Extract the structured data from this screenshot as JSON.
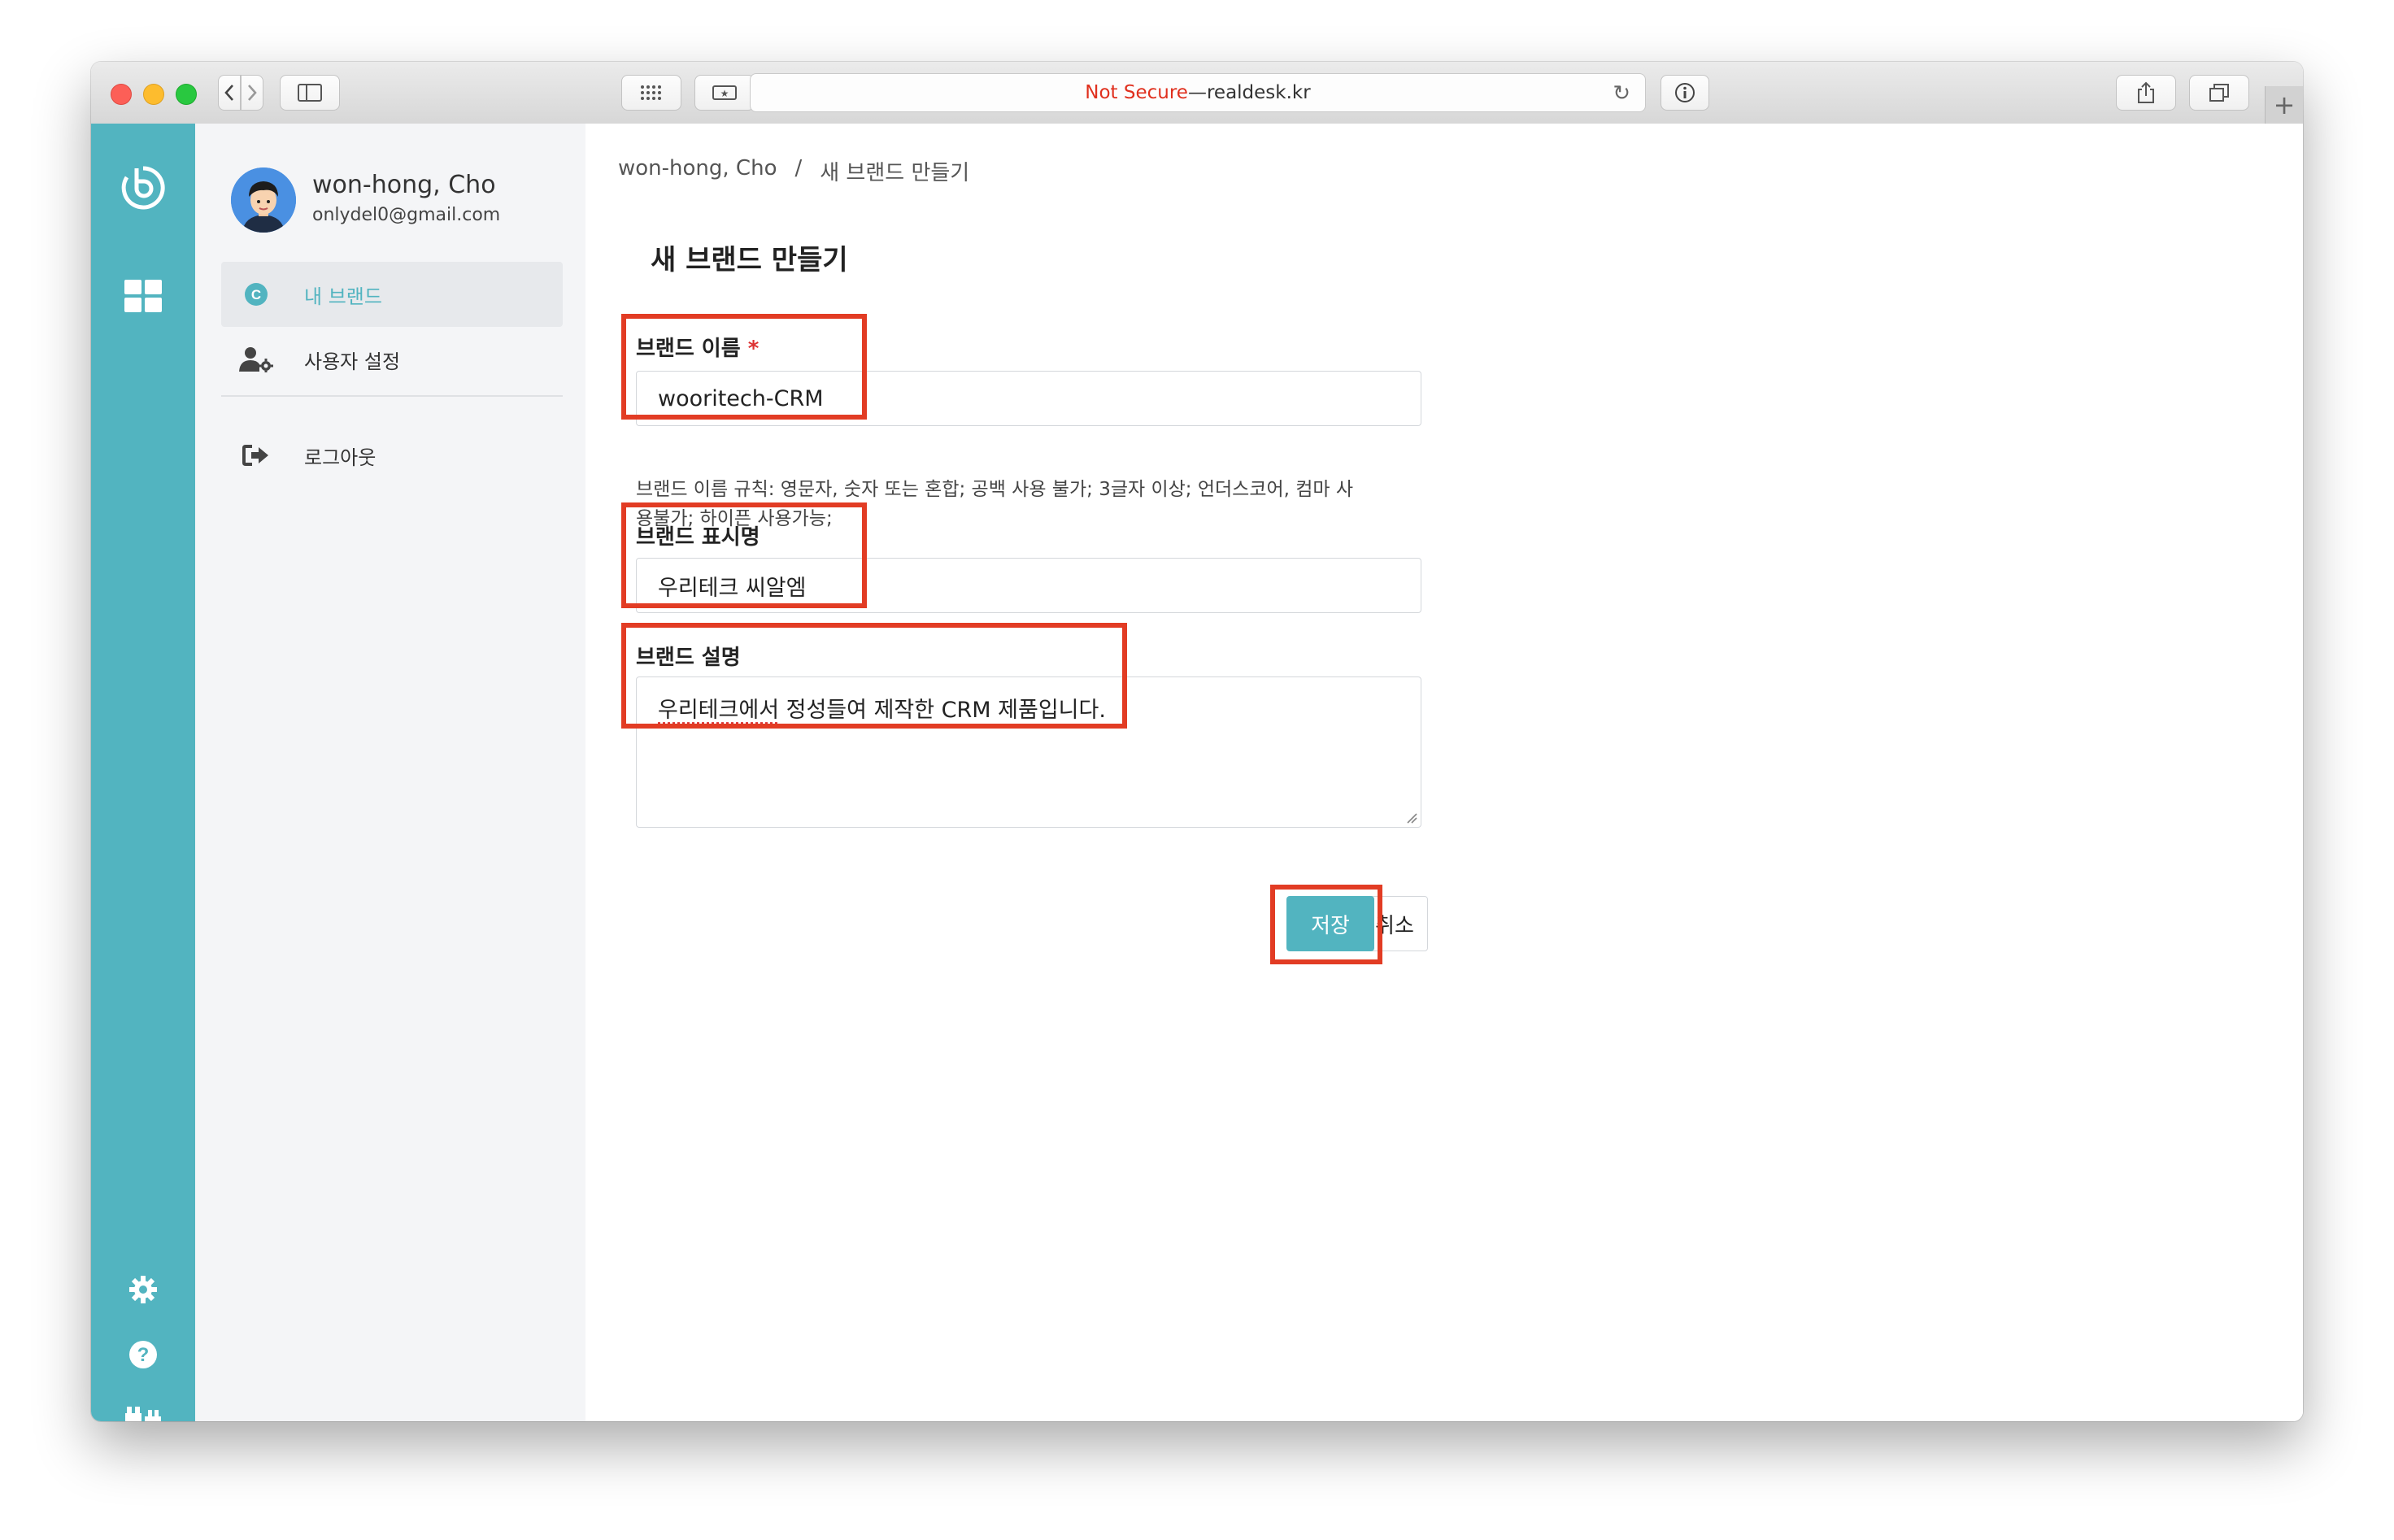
{
  "browser": {
    "not_secure": "Not Secure",
    "separator": " — ",
    "domain": "realdesk.kr"
  },
  "sidebar": {
    "user_name": "won-hong, Cho",
    "user_email": "onlydel0@gmail.com",
    "items": [
      {
        "label": "내 브랜드",
        "icon": "brand-c-icon",
        "active": true
      },
      {
        "label": "사용자 설정",
        "icon": "user-settings-icon",
        "active": false
      },
      {
        "label": "로그아웃",
        "icon": "logout-icon",
        "active": false
      }
    ]
  },
  "breadcrumb": {
    "user": "won-hong, Cho",
    "separator": "/",
    "current": "새 브랜드 만들기"
  },
  "form": {
    "title": "새 브랜드 만들기",
    "brand_name_label": "브랜드 이름",
    "required_mark": "*",
    "brand_name_value": "wooritech-CRM",
    "brand_name_help_line1": "브랜드 이름 규칙: 영문자, 숫자 또는 혼합; 공백 사용 불가; 3글자 이상; 언더스코어, 컴마 사",
    "brand_name_help_line2": "용불가; 하이픈 사용가능;",
    "display_name_label": "브랜드 표시명",
    "display_name_value": "우리테크 씨알엠",
    "description_label": "브랜드 설명",
    "description_underlined": "우리테크에서",
    "description_rest": " 정성들여 제작한 CRM 제품입니다.",
    "save_label": "저장",
    "cancel_label": "취소"
  },
  "colors": {
    "accent": "#52b4c0",
    "highlight": "#e23c24"
  }
}
